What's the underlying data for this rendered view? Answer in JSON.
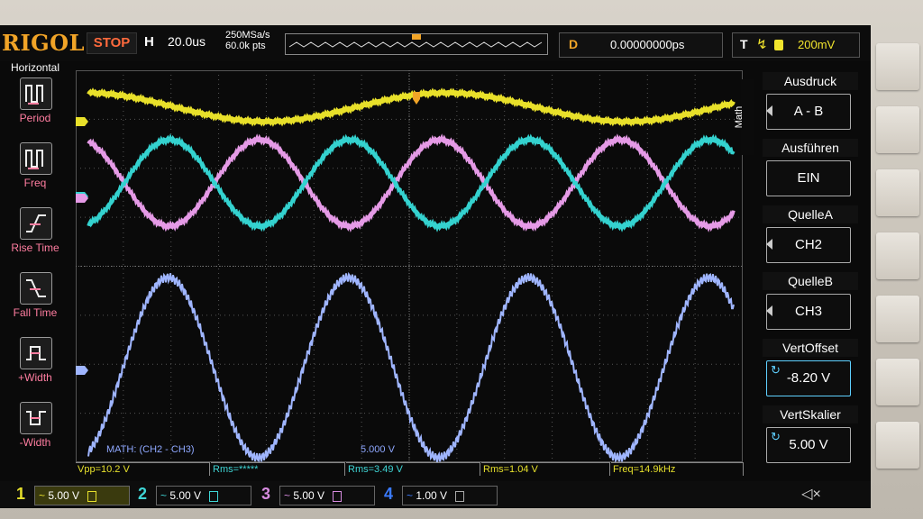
{
  "brand": "RIGOL",
  "status": "STOP",
  "timebase": {
    "label": "H",
    "value": "20.0us"
  },
  "sample": {
    "rate": "250MSa/s",
    "points": "60.0k pts"
  },
  "delay": {
    "label": "D",
    "value": "0.00000000ps"
  },
  "trigger": {
    "label": "T",
    "level": "200mV"
  },
  "left_menu": {
    "title": "Horizontal",
    "items": [
      "Period",
      "Freq",
      "Rise Time",
      "Fall Time",
      "+Width",
      "-Width"
    ]
  },
  "math_tab": "Math",
  "right_menu": [
    {
      "header": "Ausdruck",
      "value": "A - B"
    },
    {
      "header": "Ausführen",
      "value": "EIN"
    },
    {
      "header": "QuelleA",
      "value": "CH2"
    },
    {
      "header": "QuelleB",
      "value": "CH3"
    },
    {
      "header": "VertOffset",
      "value": "-8.20 V"
    },
    {
      "header": "VertSkalier",
      "value": "5.00 V"
    }
  ],
  "math_label": "MATH: (CH2 - CH3)",
  "math_scale": "5.000 V",
  "measurements": [
    {
      "text": "Vpp=10.2 V",
      "color": "#e6e02c"
    },
    {
      "text": "Rms=*****",
      "color": "#3fd6d6"
    },
    {
      "text": "Rms=3.49 V",
      "color": "#3fd6d6"
    },
    {
      "text": "Rms=1.04 V",
      "color": "#e6e02c"
    },
    {
      "text": "Freq=14.9kHz",
      "color": "#e6e02c"
    }
  ],
  "channels": [
    {
      "num": "1",
      "scale": "5.00 V",
      "color": "#e6e02c"
    },
    {
      "num": "2",
      "scale": "5.00 V",
      "color": "#3fd6d6"
    },
    {
      "num": "3",
      "scale": "5.00 V",
      "color": "#d78be0"
    },
    {
      "num": "4",
      "scale": "1.00 V",
      "color": "#3b7bff"
    }
  ],
  "waveform_colors": {
    "ch1": "#e8e02a",
    "ch2": "#34d2cf",
    "ch3": "#e59ae6",
    "math": "#9fb5ff"
  }
}
